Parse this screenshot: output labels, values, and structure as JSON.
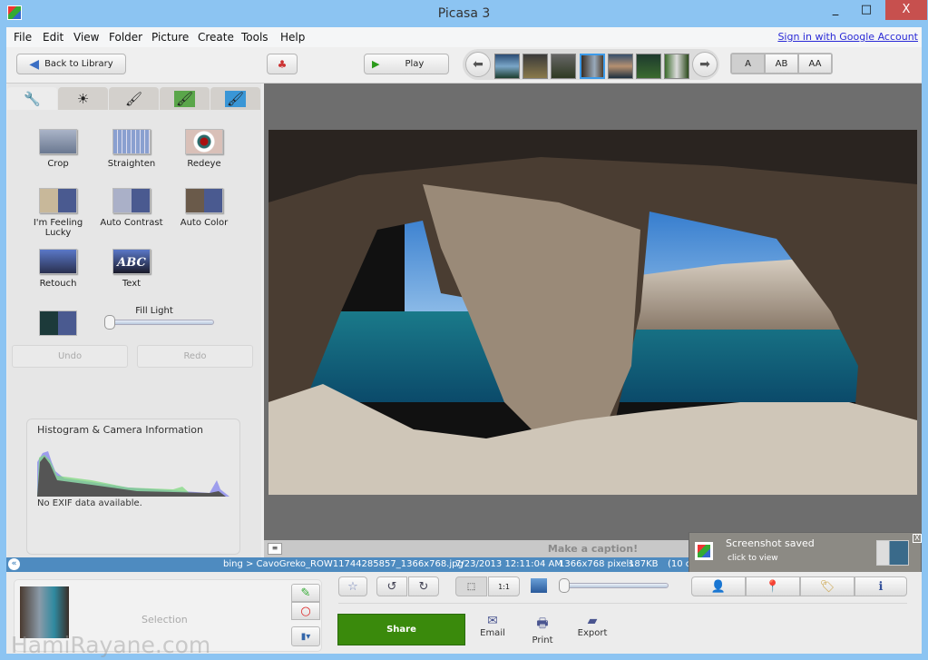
{
  "window": {
    "title": "Picasa 3",
    "min": "_",
    "max": "□",
    "close": "X"
  },
  "menu": {
    "items": [
      "File",
      "Edit",
      "View",
      "Folder",
      "Picture",
      "Create",
      "Tools",
      "Help"
    ],
    "sign_in": "Sign in with Google Account"
  },
  "toolbar": {
    "back": "Back to Library",
    "play": "Play",
    "caption_modes": [
      "A",
      "AB",
      "AA"
    ]
  },
  "edit_panel": {
    "tabs": [
      "wrench-icon",
      "tuning-icon",
      "brush-icon",
      "green-brush-icon",
      "blue-brush-icon"
    ],
    "tools": [
      "Crop",
      "Straighten",
      "Redeye",
      "I'm Feeling Lucky",
      "Auto Contrast",
      "Auto Color",
      "Retouch",
      "Text"
    ],
    "text_tool_thumb": "ABC",
    "fill_light": {
      "label": "Fill Light",
      "value": 0
    },
    "undo": "Undo",
    "redo": "Redo",
    "histogram": {
      "title": "Histogram & Camera Information",
      "exif": "No EXIF data available."
    }
  },
  "viewer": {
    "caption_placeholder": "Make a caption!"
  },
  "status": {
    "path": "bing > CavoGreko_ROW11744285857_1366x768.jpg",
    "date": "7/23/2013 12:11:04 AM",
    "dimensions": "1366x768 pixels",
    "size": "187KB",
    "count": "(10 o"
  },
  "toast": {
    "title": "Screenshot saved",
    "subtitle": "click to view",
    "close": "X"
  },
  "bottom": {
    "selection": "Selection",
    "share": "Share",
    "actions": [
      "Email",
      "Print",
      "Export"
    ],
    "zoom_value": 0
  },
  "watermark": "HamiRayane.com",
  "colors": {
    "titlebar": "#8cc4f2",
    "close": "#c7504e",
    "status": "#4e8bc0",
    "share": "#3a8a0c",
    "link": "#2a2ad6"
  }
}
